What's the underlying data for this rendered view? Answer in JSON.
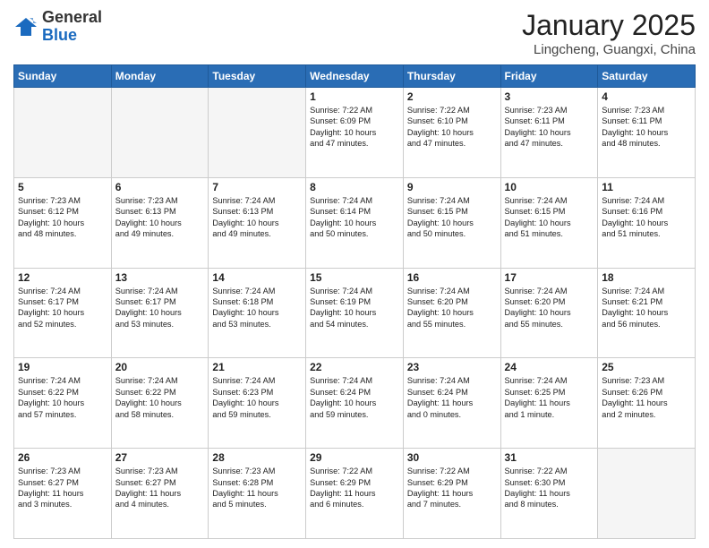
{
  "header": {
    "logo_general": "General",
    "logo_blue": "Blue",
    "month_title": "January 2025",
    "location": "Lingcheng, Guangxi, China"
  },
  "weekdays": [
    "Sunday",
    "Monday",
    "Tuesday",
    "Wednesday",
    "Thursday",
    "Friday",
    "Saturday"
  ],
  "weeks": [
    [
      {
        "day": "",
        "info": ""
      },
      {
        "day": "",
        "info": ""
      },
      {
        "day": "",
        "info": ""
      },
      {
        "day": "1",
        "info": "Sunrise: 7:22 AM\nSunset: 6:09 PM\nDaylight: 10 hours\nand 47 minutes."
      },
      {
        "day": "2",
        "info": "Sunrise: 7:22 AM\nSunset: 6:10 PM\nDaylight: 10 hours\nand 47 minutes."
      },
      {
        "day": "3",
        "info": "Sunrise: 7:23 AM\nSunset: 6:11 PM\nDaylight: 10 hours\nand 47 minutes."
      },
      {
        "day": "4",
        "info": "Sunrise: 7:23 AM\nSunset: 6:11 PM\nDaylight: 10 hours\nand 48 minutes."
      }
    ],
    [
      {
        "day": "5",
        "info": "Sunrise: 7:23 AM\nSunset: 6:12 PM\nDaylight: 10 hours\nand 48 minutes."
      },
      {
        "day": "6",
        "info": "Sunrise: 7:23 AM\nSunset: 6:13 PM\nDaylight: 10 hours\nand 49 minutes."
      },
      {
        "day": "7",
        "info": "Sunrise: 7:24 AM\nSunset: 6:13 PM\nDaylight: 10 hours\nand 49 minutes."
      },
      {
        "day": "8",
        "info": "Sunrise: 7:24 AM\nSunset: 6:14 PM\nDaylight: 10 hours\nand 50 minutes."
      },
      {
        "day": "9",
        "info": "Sunrise: 7:24 AM\nSunset: 6:15 PM\nDaylight: 10 hours\nand 50 minutes."
      },
      {
        "day": "10",
        "info": "Sunrise: 7:24 AM\nSunset: 6:15 PM\nDaylight: 10 hours\nand 51 minutes."
      },
      {
        "day": "11",
        "info": "Sunrise: 7:24 AM\nSunset: 6:16 PM\nDaylight: 10 hours\nand 51 minutes."
      }
    ],
    [
      {
        "day": "12",
        "info": "Sunrise: 7:24 AM\nSunset: 6:17 PM\nDaylight: 10 hours\nand 52 minutes."
      },
      {
        "day": "13",
        "info": "Sunrise: 7:24 AM\nSunset: 6:17 PM\nDaylight: 10 hours\nand 53 minutes."
      },
      {
        "day": "14",
        "info": "Sunrise: 7:24 AM\nSunset: 6:18 PM\nDaylight: 10 hours\nand 53 minutes."
      },
      {
        "day": "15",
        "info": "Sunrise: 7:24 AM\nSunset: 6:19 PM\nDaylight: 10 hours\nand 54 minutes."
      },
      {
        "day": "16",
        "info": "Sunrise: 7:24 AM\nSunset: 6:20 PM\nDaylight: 10 hours\nand 55 minutes."
      },
      {
        "day": "17",
        "info": "Sunrise: 7:24 AM\nSunset: 6:20 PM\nDaylight: 10 hours\nand 55 minutes."
      },
      {
        "day": "18",
        "info": "Sunrise: 7:24 AM\nSunset: 6:21 PM\nDaylight: 10 hours\nand 56 minutes."
      }
    ],
    [
      {
        "day": "19",
        "info": "Sunrise: 7:24 AM\nSunset: 6:22 PM\nDaylight: 10 hours\nand 57 minutes."
      },
      {
        "day": "20",
        "info": "Sunrise: 7:24 AM\nSunset: 6:22 PM\nDaylight: 10 hours\nand 58 minutes."
      },
      {
        "day": "21",
        "info": "Sunrise: 7:24 AM\nSunset: 6:23 PM\nDaylight: 10 hours\nand 59 minutes."
      },
      {
        "day": "22",
        "info": "Sunrise: 7:24 AM\nSunset: 6:24 PM\nDaylight: 10 hours\nand 59 minutes."
      },
      {
        "day": "23",
        "info": "Sunrise: 7:24 AM\nSunset: 6:24 PM\nDaylight: 11 hours\nand 0 minutes."
      },
      {
        "day": "24",
        "info": "Sunrise: 7:24 AM\nSunset: 6:25 PM\nDaylight: 11 hours\nand 1 minute."
      },
      {
        "day": "25",
        "info": "Sunrise: 7:23 AM\nSunset: 6:26 PM\nDaylight: 11 hours\nand 2 minutes."
      }
    ],
    [
      {
        "day": "26",
        "info": "Sunrise: 7:23 AM\nSunset: 6:27 PM\nDaylight: 11 hours\nand 3 minutes."
      },
      {
        "day": "27",
        "info": "Sunrise: 7:23 AM\nSunset: 6:27 PM\nDaylight: 11 hours\nand 4 minutes."
      },
      {
        "day": "28",
        "info": "Sunrise: 7:23 AM\nSunset: 6:28 PM\nDaylight: 11 hours\nand 5 minutes."
      },
      {
        "day": "29",
        "info": "Sunrise: 7:22 AM\nSunset: 6:29 PM\nDaylight: 11 hours\nand 6 minutes."
      },
      {
        "day": "30",
        "info": "Sunrise: 7:22 AM\nSunset: 6:29 PM\nDaylight: 11 hours\nand 7 minutes."
      },
      {
        "day": "31",
        "info": "Sunrise: 7:22 AM\nSunset: 6:30 PM\nDaylight: 11 hours\nand 8 minutes."
      },
      {
        "day": "",
        "info": ""
      }
    ]
  ]
}
